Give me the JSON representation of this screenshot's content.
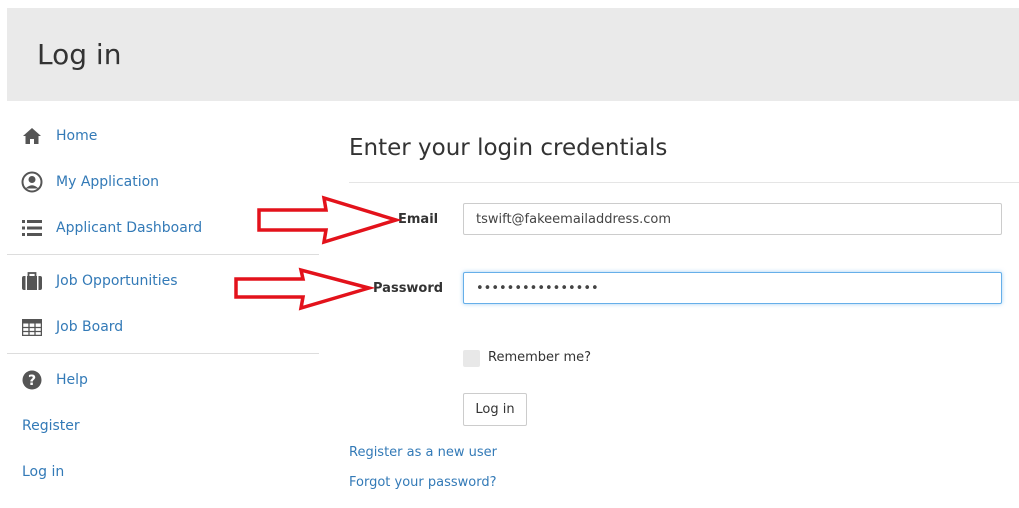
{
  "header": {
    "title": "Log in"
  },
  "sidebar": {
    "items": [
      {
        "label": "Home",
        "icon": "home-icon"
      },
      {
        "label": "My Application",
        "icon": "user-circle-icon"
      },
      {
        "label": "Applicant Dashboard",
        "icon": "list-icon"
      },
      {
        "label": "Job Opportunities",
        "icon": "briefcase-icon"
      },
      {
        "label": "Job Board",
        "icon": "table-icon"
      },
      {
        "label": "Help",
        "icon": "question-circle-icon"
      },
      {
        "label": "Register"
      },
      {
        "label": "Log in"
      }
    ]
  },
  "form": {
    "heading": "Enter your login credentials",
    "email_label": "Email",
    "email_value": "tswift@fakeemailaddress.com",
    "password_label": "Password",
    "password_value": "••••••••••••••••",
    "remember_label": "Remember me?",
    "login_button": "Log in",
    "register_link": "Register as a new user",
    "forgot_link": "Forgot your password?"
  },
  "colors": {
    "link": "#337ab7",
    "header_bg": "#eaeaea",
    "annotation_arrow": "#e3121b"
  }
}
